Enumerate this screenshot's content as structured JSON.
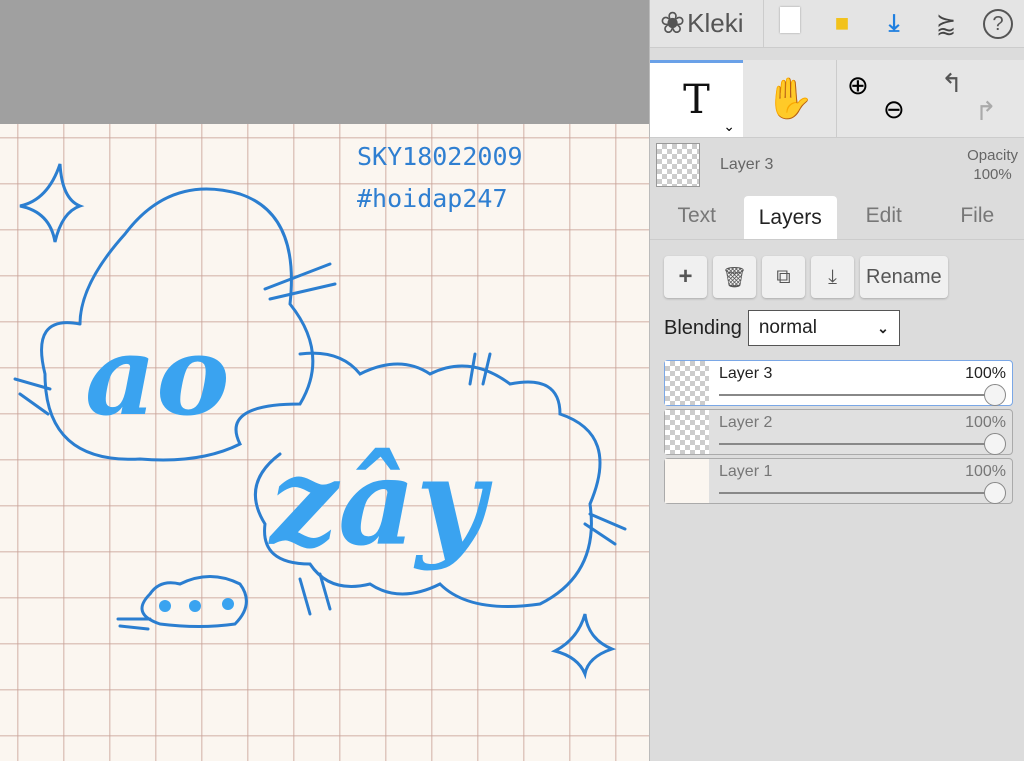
{
  "canvas": {
    "watermark_line1": "SKY18022009",
    "watermark_line2": "#hoidap247",
    "art_text": "ao zây"
  },
  "app": {
    "name": "Kleki"
  },
  "toolbar": {
    "icons": [
      "new-file-icon",
      "open-folder-icon",
      "download-icon",
      "share-icon",
      "help-icon"
    ]
  },
  "tools": {
    "text": "T"
  },
  "current_layer": {
    "name": "Layer 3",
    "opacity_label": "Opacity",
    "opacity": "100%"
  },
  "tabs": [
    {
      "label": "Text"
    },
    {
      "label": "Layers"
    },
    {
      "label": "Edit"
    },
    {
      "label": "File"
    }
  ],
  "layer_actions": {
    "rename": "Rename"
  },
  "blending": {
    "label": "Blending",
    "value": "normal"
  },
  "layers": [
    {
      "name": "Layer 3",
      "opacity": "100%",
      "value": 1.0
    },
    {
      "name": "Layer 2",
      "opacity": "100%",
      "value": 1.0
    },
    {
      "name": "Layer 1",
      "opacity": "100%",
      "value": 1.0
    }
  ],
  "colors": {
    "accent": "#2a8ae8",
    "ink": "#2f7fd1"
  }
}
